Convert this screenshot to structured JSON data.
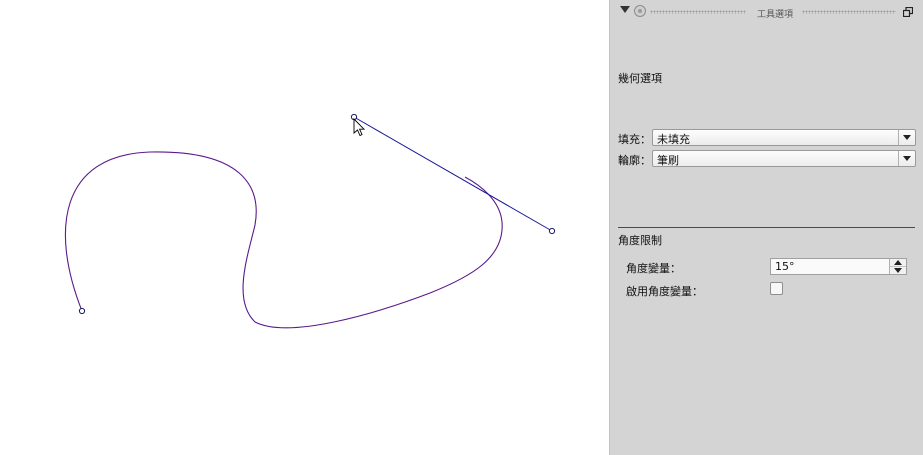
{
  "panel": {
    "title": "工具選項",
    "geometry_section": {
      "title": "幾何選項",
      "fill": {
        "label": "填充：",
        "value": "未填充"
      },
      "stroke": {
        "label": "輪廓：",
        "value": "筆刷"
      }
    },
    "angle_section": {
      "title": "角度限制",
      "angle_step": {
        "label": "角度變量：",
        "value": "15°"
      },
      "enable_angle": {
        "label": "啟用角度變量：",
        "checked": false
      }
    }
  },
  "colors": {
    "curve": "#5a1a8a",
    "handle_line": "#1a1a9a",
    "panel_bg": "#d4d4d4",
    "canvas_bg": "#ffffff"
  },
  "icons": {
    "collapse": "triangle-down-icon",
    "pin": "pin-icon",
    "float": "float-window-icon",
    "cursor": "arrow-cursor-icon"
  }
}
